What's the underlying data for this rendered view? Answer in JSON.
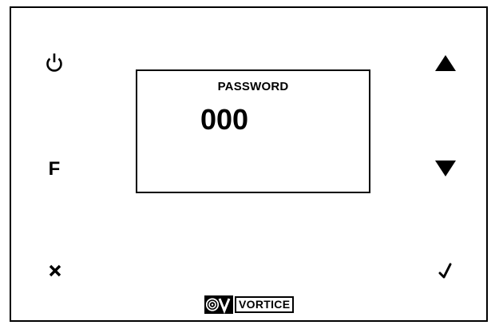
{
  "display": {
    "label": "PASSWORD",
    "value": "000"
  },
  "buttons": {
    "power": {
      "icon": "power-icon"
    },
    "function": {
      "label": "F"
    },
    "cancel": {
      "icon": "close-icon"
    },
    "up": {
      "icon": "triangle-up-icon"
    },
    "down": {
      "icon": "triangle-down-icon"
    },
    "confirm": {
      "icon": "check-icon"
    }
  },
  "brand": {
    "name": "VORTICE",
    "logo_icon": "vortice-logo-icon"
  },
  "colors": {
    "ink": "#000000",
    "background": "#ffffff"
  }
}
